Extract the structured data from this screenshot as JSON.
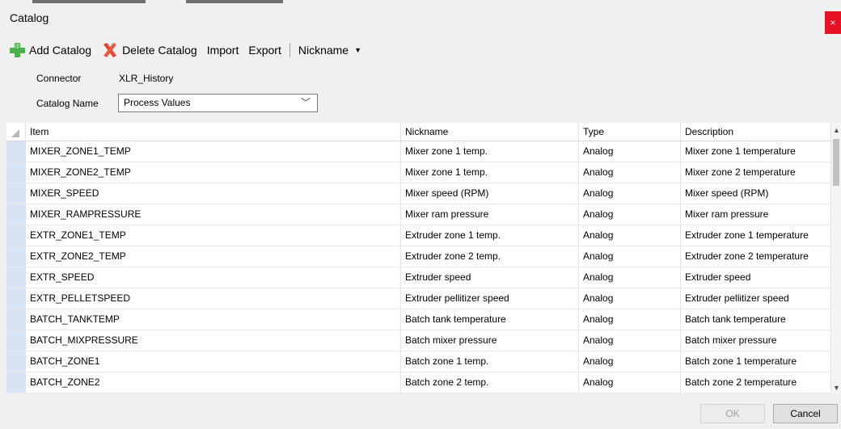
{
  "window": {
    "title": "Catalog",
    "close_label": "×"
  },
  "toolbar": {
    "add_label": "Add Catalog",
    "delete_label": "Delete Catalog",
    "import_label": "Import",
    "export_label": "Export",
    "nickname_label": "Nickname"
  },
  "form": {
    "connector_label": "Connector",
    "connector_value": "XLR_History",
    "catalog_label": "Catalog Name",
    "catalog_value": "Process Values"
  },
  "grid": {
    "columns": [
      "Item",
      "Nickname",
      "Type",
      "Description"
    ],
    "rows": [
      [
        "MIXER_ZONE1_TEMP",
        "Mixer zone 1 temp.",
        "Analog",
        "Mixer zone 1 temperature"
      ],
      [
        "MIXER_ZONE2_TEMP",
        "Mixer zone 1 temp.",
        "Analog",
        "Mixer zone 2 temperature"
      ],
      [
        "MIXER_SPEED",
        "Mixer speed (RPM)",
        "Analog",
        "Mixer speed (RPM)"
      ],
      [
        "MIXER_RAMPRESSURE",
        "Mixer ram pressure",
        "Analog",
        "Mixer ram pressure"
      ],
      [
        "EXTR_ZONE1_TEMP",
        "Extruder zone 1 temp.",
        "Analog",
        "Extruder zone 1 temperature"
      ],
      [
        "EXTR_ZONE2_TEMP",
        "Extruder zone 2 temp.",
        "Analog",
        "Extruder zone 2 temperature"
      ],
      [
        "EXTR_SPEED",
        "Extruder speed",
        "Analog",
        "Extruder speed"
      ],
      [
        "EXTR_PELLETSPEED",
        "Extruder pellitizer speed",
        "Analog",
        "Extruder pellitizer speed"
      ],
      [
        "BATCH_TANKTEMP",
        "Batch tank temperature",
        "Analog",
        "Batch tank temperature"
      ],
      [
        "BATCH_MIXPRESSURE",
        "Batch mixer pressure",
        "Analog",
        "Batch mixer pressure"
      ],
      [
        "BATCH_ZONE1",
        "Batch zone 1 temp.",
        "Analog",
        "Batch zone 1 temperature"
      ],
      [
        "BATCH_ZONE2",
        "Batch zone 2 temp.",
        "Analog",
        "Batch zone 2 temperature"
      ]
    ]
  },
  "buttons": {
    "ok_label": "OK",
    "cancel_label": "Cancel"
  },
  "icons": {
    "add": "plus-icon",
    "delete": "x-icon",
    "dropdown": "caret-down-icon"
  },
  "colors": {
    "add_icon": "#4caf50",
    "delete_icon": "#e8412c",
    "close": "#e81123",
    "row_header": "#d6e4f5"
  }
}
